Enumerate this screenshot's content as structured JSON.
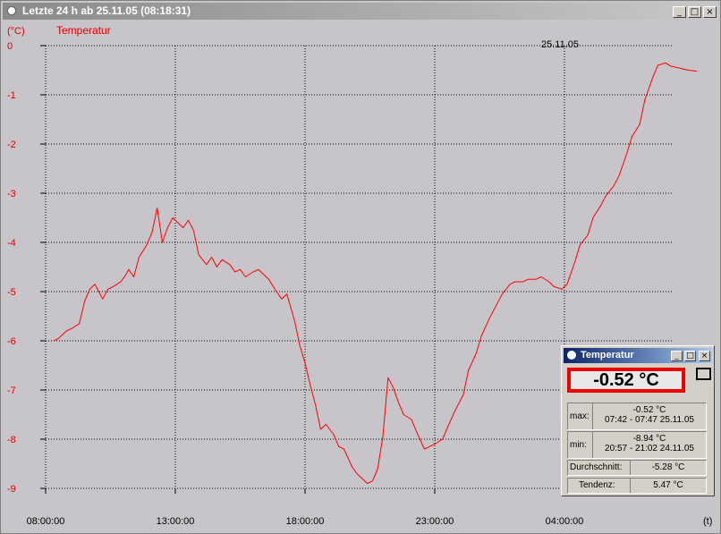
{
  "window": {
    "title": "Letzte 24 h ab 25.11.05 (08:18:31)",
    "buttons": [
      "_",
      "□",
      "×"
    ]
  },
  "chart_data": {
    "type": "line",
    "y_unit_label": "(°C)",
    "series_label": "Temperatur",
    "x_unit_label": "(t)",
    "date_marker": "25.11.05",
    "ylim": [
      -9,
      0
    ],
    "y_ticks": [
      "0",
      "-1",
      "-2",
      "-3",
      "-4",
      "-5",
      "-6",
      "-7",
      "-8",
      "-9"
    ],
    "x_tick_labels": [
      "08:00:00",
      "13:00:00",
      "18:00:00",
      "23:00:00",
      "04:00:00"
    ],
    "x_tick_hours": [
      8,
      13,
      18,
      23,
      28
    ],
    "grid": true,
    "line_color": "#ff0000",
    "series": [
      {
        "x": [
          8.3,
          8.5,
          8.8,
          9.0,
          9.3,
          9.5,
          9.7,
          9.9,
          10.2,
          10.4,
          10.6,
          10.9,
          11.1,
          11.2,
          11.4,
          11.6,
          11.9,
          12.1,
          12.3,
          12.5,
          12.7,
          12.9,
          13.1,
          13.3,
          13.5,
          13.7,
          13.9,
          14.2,
          14.4,
          14.6,
          14.8,
          15.1,
          15.3,
          15.5,
          15.7,
          16.0,
          16.2,
          16.4,
          16.6,
          16.9,
          17.1,
          17.3,
          17.6,
          17.8,
          18.0,
          18.2,
          18.4,
          18.6,
          18.8,
          19.1,
          19.3,
          19.5,
          19.8,
          20.0,
          20.2,
          20.4,
          20.6,
          20.8,
          21.0,
          21.2,
          21.4,
          21.6,
          21.8,
          22.1,
          22.3,
          22.6,
          22.8,
          23.0,
          23.3,
          23.5,
          23.8,
          24.1,
          24.3,
          24.6,
          24.8,
          25.1,
          25.4,
          25.6,
          25.9,
          26.1,
          26.4,
          26.6,
          26.9,
          27.1,
          27.4,
          27.6,
          27.9,
          28.1,
          28.4,
          28.6,
          28.9,
          29.1,
          29.4,
          29.6,
          29.9,
          30.1,
          30.4,
          30.6,
          30.9,
          31.1,
          31.4,
          31.6,
          31.9,
          32.1,
          32.4,
          32.6,
          32.8,
          33.1
        ],
        "y": [
          -6.0,
          -5.95,
          -5.8,
          -5.75,
          -5.65,
          -5.2,
          -4.95,
          -4.85,
          -5.15,
          -4.95,
          -4.9,
          -4.8,
          -4.65,
          -4.55,
          -4.7,
          -4.3,
          -4.05,
          -3.8,
          -3.3,
          -4.0,
          -3.7,
          -3.5,
          -3.6,
          -3.7,
          -3.55,
          -3.75,
          -4.25,
          -4.45,
          -4.3,
          -4.5,
          -4.35,
          -4.45,
          -4.6,
          -4.55,
          -4.7,
          -4.6,
          -4.55,
          -4.65,
          -4.75,
          -5.0,
          -5.15,
          -5.05,
          -5.6,
          -6.1,
          -6.45,
          -6.9,
          -7.3,
          -7.8,
          -7.7,
          -7.9,
          -8.15,
          -8.2,
          -8.55,
          -8.7,
          -8.8,
          -8.9,
          -8.85,
          -8.6,
          -7.95,
          -6.75,
          -6.95,
          -7.25,
          -7.5,
          -7.6,
          -7.85,
          -8.2,
          -8.15,
          -8.1,
          -8.0,
          -7.75,
          -7.4,
          -7.1,
          -6.6,
          -6.25,
          -5.9,
          -5.55,
          -5.25,
          -5.05,
          -4.85,
          -4.8,
          -4.8,
          -4.75,
          -4.75,
          -4.7,
          -4.8,
          -4.9,
          -4.95,
          -4.85,
          -4.4,
          -4.05,
          -3.85,
          -3.5,
          -3.25,
          -3.05,
          -2.85,
          -2.65,
          -2.2,
          -1.85,
          -1.6,
          -1.1,
          -0.65,
          -0.4,
          -0.35,
          -0.42,
          -0.45,
          -0.48,
          -0.5,
          -0.52
        ]
      }
    ]
  },
  "popup": {
    "title": "Temperatur",
    "buttons": [
      "_",
      "□",
      "×"
    ],
    "current_value": "-0.52 °C",
    "max_label": "max:",
    "max_value": "-0.52 °C",
    "max_time": "07:42 - 07:47  25.11.05",
    "min_label": "min:",
    "min_value": "-8.94 °C",
    "min_time": "20:57 - 21:02  24.11.05",
    "avg_label": "Durchschnitt:",
    "avg_value": "-5.28 °C",
    "trend_label": "Tendenz:",
    "trend_value": "5.47 °C"
  }
}
